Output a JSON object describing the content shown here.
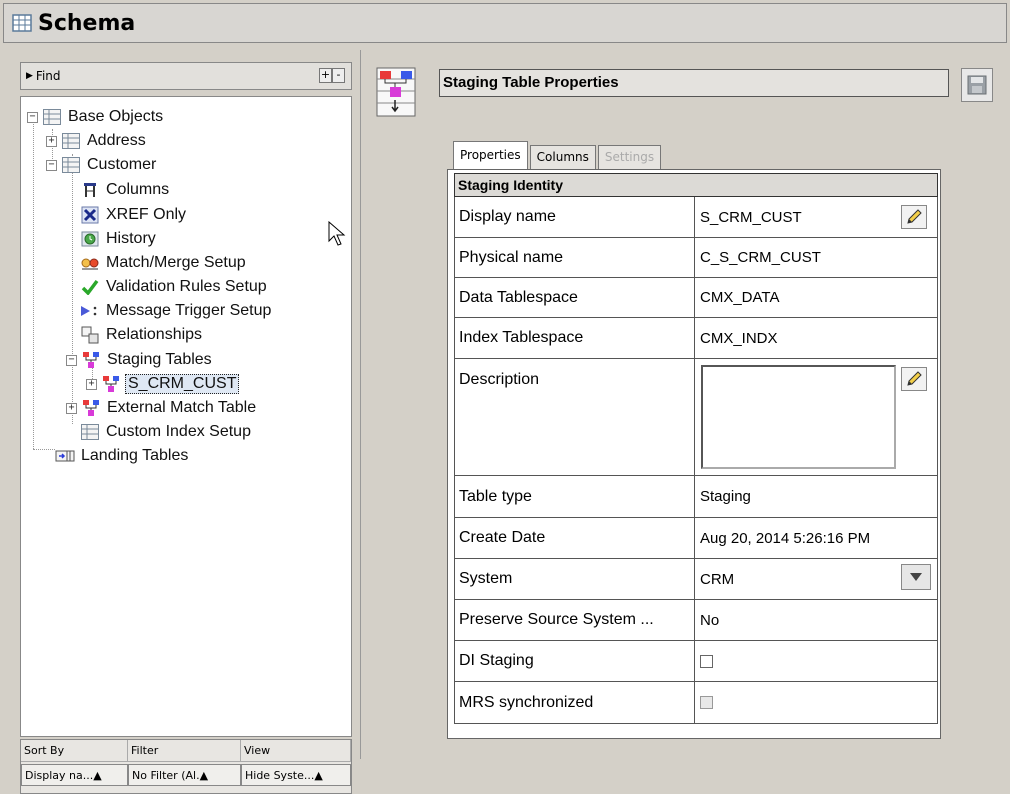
{
  "window": {
    "title": "Schema"
  },
  "find": {
    "label": "Find",
    "plus": "+",
    "minus": "-"
  },
  "tree": {
    "base_objects": "Base Objects",
    "address": "Address",
    "customer": "Customer",
    "columns": "Columns",
    "xref_only": "XREF Only",
    "history": "History",
    "match_merge": "Match/Merge Setup",
    "validation_rules": "Validation Rules Setup",
    "message_trigger": "Message Trigger Setup",
    "relationships": "Relationships",
    "staging_tables": "Staging Tables",
    "s_crm_cust": "S_CRM_CUST",
    "external_match": "External Match Table",
    "custom_index": "Custom Index Setup",
    "landing_tables": "Landing Tables"
  },
  "sort_panel": {
    "headers": [
      "Sort By",
      "Filter",
      "View"
    ],
    "values": [
      "Display na...▲",
      "No Filter (Al.▲",
      "Hide Syste...▲"
    ]
  },
  "panel": {
    "title": "Staging Table Properties"
  },
  "tabs": [
    {
      "label": "Properties",
      "state": "active"
    },
    {
      "label": "Columns",
      "state": "normal"
    },
    {
      "label": "Settings",
      "state": "disabled"
    }
  ],
  "properties": {
    "group_title": "Staging Identity",
    "display_name_label": "Display name",
    "display_name_value": "S_CRM_CUST",
    "physical_name_label": "Physical name",
    "physical_name_value": "C_S_CRM_CUST",
    "data_tablespace_label": "Data Tablespace",
    "data_tablespace_value": "CMX_DATA",
    "index_tablespace_label": "Index Tablespace",
    "index_tablespace_value": "CMX_INDX",
    "description_label": "Description",
    "table_type_label": "Table type",
    "table_type_value": "Staging",
    "create_date_label": "Create Date",
    "create_date_value": "Aug 20, 2014 5:26:16 PM",
    "system_label": "System",
    "system_value": "CRM",
    "preserve_label": "Preserve Source System ...",
    "preserve_value": "No",
    "di_staging_label": "DI Staging",
    "di_staging_checked": false,
    "mrs_label": "MRS synchronized",
    "mrs_checked": false
  }
}
